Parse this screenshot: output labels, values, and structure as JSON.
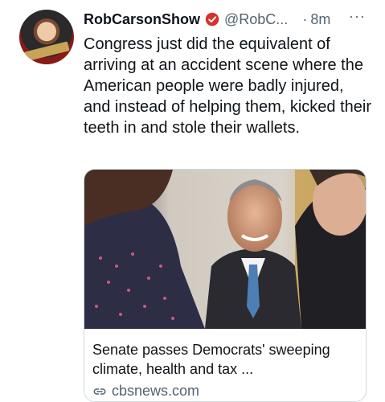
{
  "tweet": {
    "author_name": "RobCarsonShow",
    "handle": "@RobC...",
    "separator": "·",
    "time_ago": "8m",
    "more_label": "···",
    "body": "Congress just did the equivalent of arriving at an accident scene where the American people were badly injured, and instead of helping them, kicked their teeth in and stole their wallets.",
    "avatar_icon": "avatar-photo",
    "badge_icon": "verified-badge-icon",
    "badge_color": "#d6312b"
  },
  "card": {
    "title": "Senate passes Democrats' sweeping climate, health and tax ...",
    "domain": "cbsnews.com",
    "image_icon": "news-photo"
  }
}
